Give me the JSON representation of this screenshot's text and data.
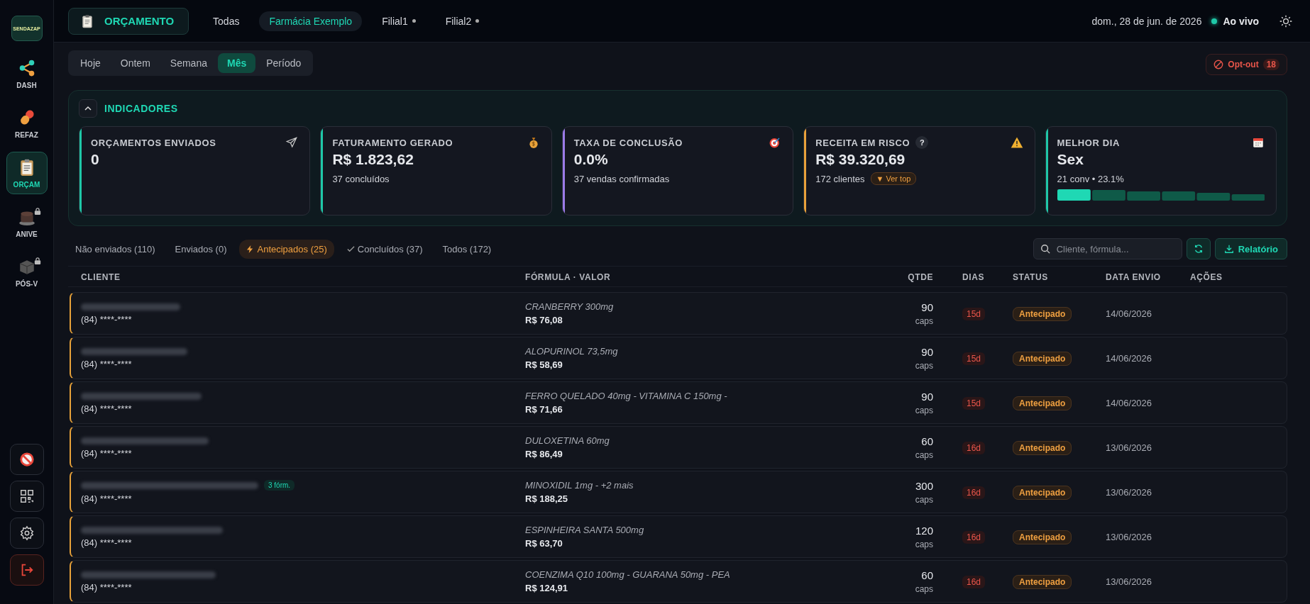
{
  "sidebar": {
    "logo": "SENDAZAP",
    "items": [
      {
        "label": "DASH",
        "selected": false,
        "locked": false
      },
      {
        "label": "REFAZ",
        "selected": false,
        "locked": false
      },
      {
        "label": "ORÇAM",
        "selected": true,
        "locked": false
      },
      {
        "label": "ANIVE",
        "selected": false,
        "locked": true
      },
      {
        "label": "PÓS-V",
        "selected": false,
        "locked": true
      }
    ]
  },
  "header": {
    "title": "ORÇAMENTO",
    "stores": [
      {
        "label": "Todas",
        "selected": false,
        "dot": false
      },
      {
        "label": "Farmácia Exemplo",
        "selected": true,
        "dot": false
      },
      {
        "label": "Filial1",
        "selected": false,
        "dot": true
      },
      {
        "label": "Filial2",
        "selected": false,
        "dot": true
      }
    ],
    "date": "dom., 28 de jun. de 2026",
    "live": "Ao vivo"
  },
  "periods": [
    {
      "label": "Hoje",
      "selected": false
    },
    {
      "label": "Ontem",
      "selected": false
    },
    {
      "label": "Semana",
      "selected": false
    },
    {
      "label": "Mês",
      "selected": true
    },
    {
      "label": "Período",
      "selected": false
    }
  ],
  "opt_out": {
    "label": "Opt-out",
    "count": "18"
  },
  "indicators": {
    "title": "INDICADORES",
    "expanded": true,
    "cards": [
      {
        "kind": "plain",
        "title": "ORÇAMENTOS ENVIADOS",
        "value": "0",
        "color": "#1fc8a8"
      },
      {
        "kind": "plain",
        "title": "FATURAMENTO GERADO",
        "value": "R$ 1.823,62",
        "sub": "37 concluídos",
        "color": "#1fc8a8"
      },
      {
        "kind": "plain",
        "title": "TAXA DE CONCLUSÃO",
        "value": "0.0%",
        "sub": "37 vendas confirmadas",
        "color": "#9b7be8"
      },
      {
        "kind": "risk",
        "title": "RECEITA EM RISCO",
        "help": "?",
        "value": "R$ 39.320,69",
        "sub": "172 clientes",
        "action": "▼ Ver top",
        "color": "#e8a23a"
      },
      {
        "kind": "best_day",
        "title": "MELHOR DIA",
        "value": "Sex",
        "sub": "21 conv • 23.1%",
        "color": "#1fc8a8"
      }
    ]
  },
  "filters": [
    {
      "kind": "plain",
      "label": "Não enviados (110)",
      "selected": false
    },
    {
      "kind": "plain",
      "label": "Enviados (0)",
      "selected": false
    },
    {
      "kind": "bolt",
      "label": "Antecipados (25)",
      "selected": true
    },
    {
      "kind": "check",
      "label": "Concluídos (37)",
      "selected": false
    },
    {
      "kind": "plain",
      "label": "Todos (172)",
      "selected": false
    }
  ],
  "search": {
    "placeholder": "Cliente, fórmula..."
  },
  "report_button": "Relatório",
  "table": {
    "columns": [
      "CLIENTE",
      "FÓRMULA · VALOR",
      "QTDE",
      "DIAS",
      "STATUS",
      "DATA ENVIO",
      "AÇÕES"
    ],
    "rows": [
      {
        "phone": "(84) ****-****",
        "formula": "CRANBERRY 300mg",
        "value": "R$ 76,08",
        "qty": "90",
        "unit": "caps",
        "days": "15d",
        "status": "Antecipado",
        "date": "14/06/2026"
      },
      {
        "phone": "(84) ****-****",
        "formula": "ALOPURINOL 73,5mg",
        "value": "R$ 58,69",
        "qty": "90",
        "unit": "caps",
        "days": "15d",
        "status": "Antecipado",
        "date": "14/06/2026"
      },
      {
        "phone": "(84) ****-****",
        "formula": "FERRO QUELADO 40mg - VITAMINA C 150mg -",
        "value": "R$ 71,66",
        "qty": "90",
        "unit": "caps",
        "days": "15d",
        "status": "Antecipado",
        "date": "14/06/2026"
      },
      {
        "phone": "(84) ****-****",
        "formula": "DULOXETINA 60mg",
        "value": "R$ 86,49",
        "qty": "60",
        "unit": "caps",
        "days": "16d",
        "status": "Antecipado",
        "date": "13/06/2026"
      },
      {
        "phone": "(84) ****-****",
        "badge": "3 fórm.",
        "formula": "MINOXIDIL 1mg -  +2 mais",
        "value": "R$ 188,25",
        "qty": "300",
        "unit": "caps",
        "days": "16d",
        "status": "Antecipado",
        "date": "13/06/2026"
      },
      {
        "phone": "(84) ****-****",
        "formula": "ESPINHEIRA SANTA 500mg",
        "value": "R$ 63,70",
        "qty": "120",
        "unit": "caps",
        "days": "16d",
        "status": "Antecipado",
        "date": "13/06/2026"
      },
      {
        "phone": "(84) ****-****",
        "formula": "COENZIMA Q10 100mg - GUARANA 50mg - PEA",
        "value": "R$ 124,91",
        "qty": "60",
        "unit": "caps",
        "days": "16d",
        "status": "Antecipado",
        "date": "13/06/2026"
      }
    ]
  }
}
